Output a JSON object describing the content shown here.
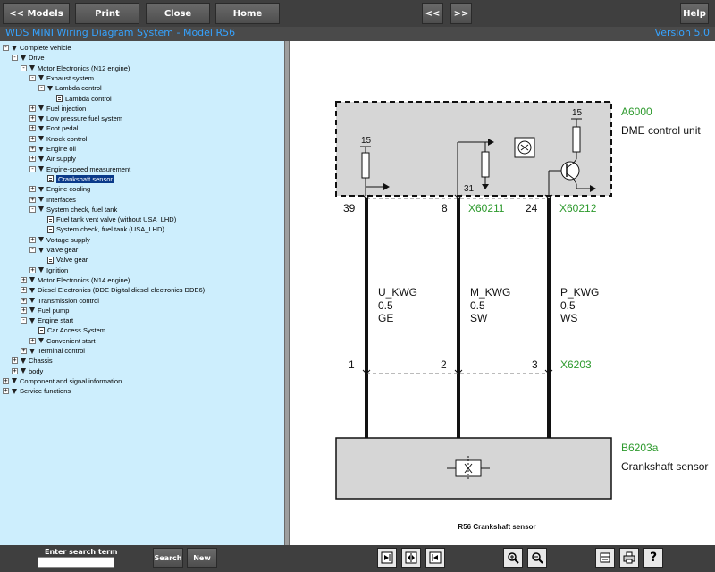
{
  "toolbar": {
    "models": "<< Models",
    "print": "Print",
    "close": "Close",
    "home": "Home",
    "back": "<<",
    "forward": ">>",
    "help": "Help"
  },
  "header": {
    "title": "WDS MINI Wiring Diagram System - Model R56",
    "version": "Version 5.0"
  },
  "tree": [
    {
      "label": "Complete vehicle",
      "level": 0,
      "exp": "-",
      "icon": "arrow"
    },
    {
      "label": "Drive",
      "level": 1,
      "exp": "-",
      "icon": "arrow"
    },
    {
      "label": "Motor Electronics (N12 engine)",
      "level": 2,
      "exp": "-",
      "icon": "arrow"
    },
    {
      "label": "Exhaust system",
      "level": 3,
      "exp": "-",
      "icon": "arrow"
    },
    {
      "label": "Lambda control",
      "level": 4,
      "exp": "-",
      "icon": "arrow"
    },
    {
      "label": "Lambda control",
      "level": 5,
      "exp": "",
      "icon": "doc"
    },
    {
      "label": "Fuel injection",
      "level": 3,
      "exp": "+",
      "icon": "arrow"
    },
    {
      "label": "Low pressure fuel system",
      "level": 3,
      "exp": "+",
      "icon": "arrow"
    },
    {
      "label": "Foot pedal",
      "level": 3,
      "exp": "+",
      "icon": "arrow"
    },
    {
      "label": "Knock control",
      "level": 3,
      "exp": "+",
      "icon": "arrow"
    },
    {
      "label": "Engine oil",
      "level": 3,
      "exp": "+",
      "icon": "arrow"
    },
    {
      "label": "Air supply",
      "level": 3,
      "exp": "+",
      "icon": "arrow"
    },
    {
      "label": "Engine-speed measurement",
      "level": 3,
      "exp": "-",
      "icon": "arrow"
    },
    {
      "label": "Crankshaft sensor",
      "level": 4,
      "exp": "",
      "icon": "doc",
      "selected": true
    },
    {
      "label": "Engine cooling",
      "level": 3,
      "exp": "+",
      "icon": "arrow"
    },
    {
      "label": "Interfaces",
      "level": 3,
      "exp": "+",
      "icon": "arrow"
    },
    {
      "label": "System check, fuel tank",
      "level": 3,
      "exp": "-",
      "icon": "arrow"
    },
    {
      "label": "Fuel tank vent valve (without USA_LHD)",
      "level": 4,
      "exp": "",
      "icon": "doc"
    },
    {
      "label": "System check, fuel tank (USA_LHD)",
      "level": 4,
      "exp": "",
      "icon": "doc"
    },
    {
      "label": "Voltage supply",
      "level": 3,
      "exp": "+",
      "icon": "arrow"
    },
    {
      "label": "Valve gear",
      "level": 3,
      "exp": "-",
      "icon": "arrow"
    },
    {
      "label": "Valve gear",
      "level": 4,
      "exp": "",
      "icon": "doc"
    },
    {
      "label": "Ignition",
      "level": 3,
      "exp": "+",
      "icon": "arrow"
    },
    {
      "label": "Motor Electronics (N14 engine)",
      "level": 2,
      "exp": "+",
      "icon": "arrow"
    },
    {
      "label": "Diesel Electronics (DDE Digital diesel electronics DDE6)",
      "level": 2,
      "exp": "+",
      "icon": "arrow"
    },
    {
      "label": "Transmission control",
      "level": 2,
      "exp": "+",
      "icon": "arrow"
    },
    {
      "label": "Fuel pump",
      "level": 2,
      "exp": "+",
      "icon": "arrow"
    },
    {
      "label": "Engine start",
      "level": 2,
      "exp": "-",
      "icon": "arrow"
    },
    {
      "label": "Car Access System",
      "level": 3,
      "exp": "",
      "icon": "doc"
    },
    {
      "label": "Convenient start",
      "level": 3,
      "exp": "+",
      "icon": "arrow"
    },
    {
      "label": "Terminal control",
      "level": 2,
      "exp": "+",
      "icon": "arrow"
    },
    {
      "label": "Chassis",
      "level": 1,
      "exp": "+",
      "icon": "arrow"
    },
    {
      "label": "body",
      "level": 1,
      "exp": "+",
      "icon": "arrow"
    },
    {
      "label": "Component and signal information",
      "level": 0,
      "exp": "+",
      "icon": "arrow"
    },
    {
      "label": "Service functions",
      "level": 0,
      "exp": "+",
      "icon": "arrow"
    }
  ],
  "diagram": {
    "dme_id": "A6000",
    "dme_name": "DME control unit",
    "pin_15a": "15",
    "pin_15b": "15",
    "pin_31": "31",
    "pin_39": "39",
    "pin_8": "8",
    "pin_24": "24",
    "conn_1": "X60211",
    "conn_2": "X60212",
    "w1_name": "U_KWG",
    "w1_size": "0.5",
    "w1_color": "GE",
    "w2_name": "M_KWG",
    "w2_size": "0.5",
    "w2_color": "SW",
    "w3_name": "P_KWG",
    "w3_size": "0.5",
    "w3_color": "WS",
    "pin_1": "1",
    "pin_2": "2",
    "pin_3": "3",
    "conn_3": "X6203",
    "sensor_id": "B6203a",
    "sensor_name": "Crankshaft sensor",
    "caption": "R56 Crankshaft sensor",
    "accent_color": "#2e9a2e"
  },
  "bottom": {
    "search_label": "Enter search term",
    "search_value": "",
    "search_button": "Search",
    "new_button": "New"
  }
}
